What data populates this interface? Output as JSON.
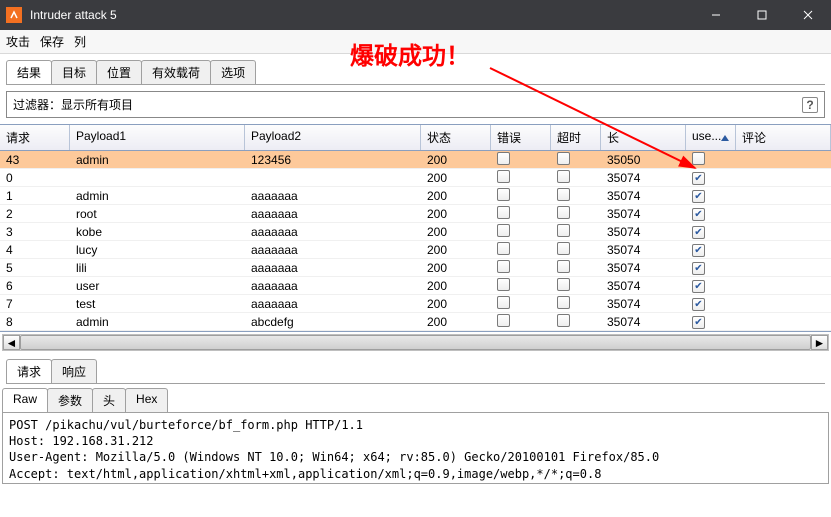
{
  "window": {
    "title": "Intruder attack 5"
  },
  "menu": {
    "attack": "攻击",
    "save": "保存",
    "columns": "列"
  },
  "annotation": "爆破成功！",
  "tabs": {
    "results": "结果",
    "target": "目标",
    "positions": "位置",
    "payloads": "有效载荷",
    "options": "选项"
  },
  "filter": {
    "label": "过滤器：显示所有项目"
  },
  "columns": {
    "request": "请求",
    "payload1": "Payload1",
    "payload2": "Payload2",
    "status": "状态",
    "error": "错误",
    "timeout": "超时",
    "length": "长",
    "user": "use...",
    "comment": "评论"
  },
  "rows": [
    {
      "req": "43",
      "p1": "admin",
      "p2": "123456",
      "status": "200",
      "err": false,
      "to": false,
      "len": "35050",
      "user": false,
      "hl": true
    },
    {
      "req": "0",
      "p1": "",
      "p2": "",
      "status": "200",
      "err": false,
      "to": false,
      "len": "35074",
      "user": true,
      "hl": false
    },
    {
      "req": "1",
      "p1": "admin",
      "p2": "aaaaaaa",
      "status": "200",
      "err": false,
      "to": false,
      "len": "35074",
      "user": true,
      "hl": false
    },
    {
      "req": "2",
      "p1": "root",
      "p2": "aaaaaaa",
      "status": "200",
      "err": false,
      "to": false,
      "len": "35074",
      "user": true,
      "hl": false
    },
    {
      "req": "3",
      "p1": "kobe",
      "p2": "aaaaaaa",
      "status": "200",
      "err": false,
      "to": false,
      "len": "35074",
      "user": true,
      "hl": false
    },
    {
      "req": "4",
      "p1": "lucy",
      "p2": "aaaaaaa",
      "status": "200",
      "err": false,
      "to": false,
      "len": "35074",
      "user": true,
      "hl": false
    },
    {
      "req": "5",
      "p1": "lili",
      "p2": "aaaaaaa",
      "status": "200",
      "err": false,
      "to": false,
      "len": "35074",
      "user": true,
      "hl": false
    },
    {
      "req": "6",
      "p1": "user",
      "p2": "aaaaaaa",
      "status": "200",
      "err": false,
      "to": false,
      "len": "35074",
      "user": true,
      "hl": false
    },
    {
      "req": "7",
      "p1": "test",
      "p2": "aaaaaaa",
      "status": "200",
      "err": false,
      "to": false,
      "len": "35074",
      "user": true,
      "hl": false
    },
    {
      "req": "8",
      "p1": "admin",
      "p2": "abcdefg",
      "status": "200",
      "err": false,
      "to": false,
      "len": "35074",
      "user": true,
      "hl": false
    }
  ],
  "lower_tabs": {
    "request": "请求",
    "response": "响应"
  },
  "view_tabs": {
    "raw": "Raw",
    "params": "参数",
    "headers": "头",
    "hex": "Hex"
  },
  "request_text": "POST /pikachu/vul/burteforce/bf_form.php HTTP/1.1\nHost: 192.168.31.212\nUser-Agent: Mozilla/5.0 (Windows NT 10.0; Win64; x64; rv:85.0) Gecko/20100101 Firefox/85.0\nAccept: text/html,application/xhtml+xml,application/xml;q=0.9,image/webp,*/*;q=0.8"
}
